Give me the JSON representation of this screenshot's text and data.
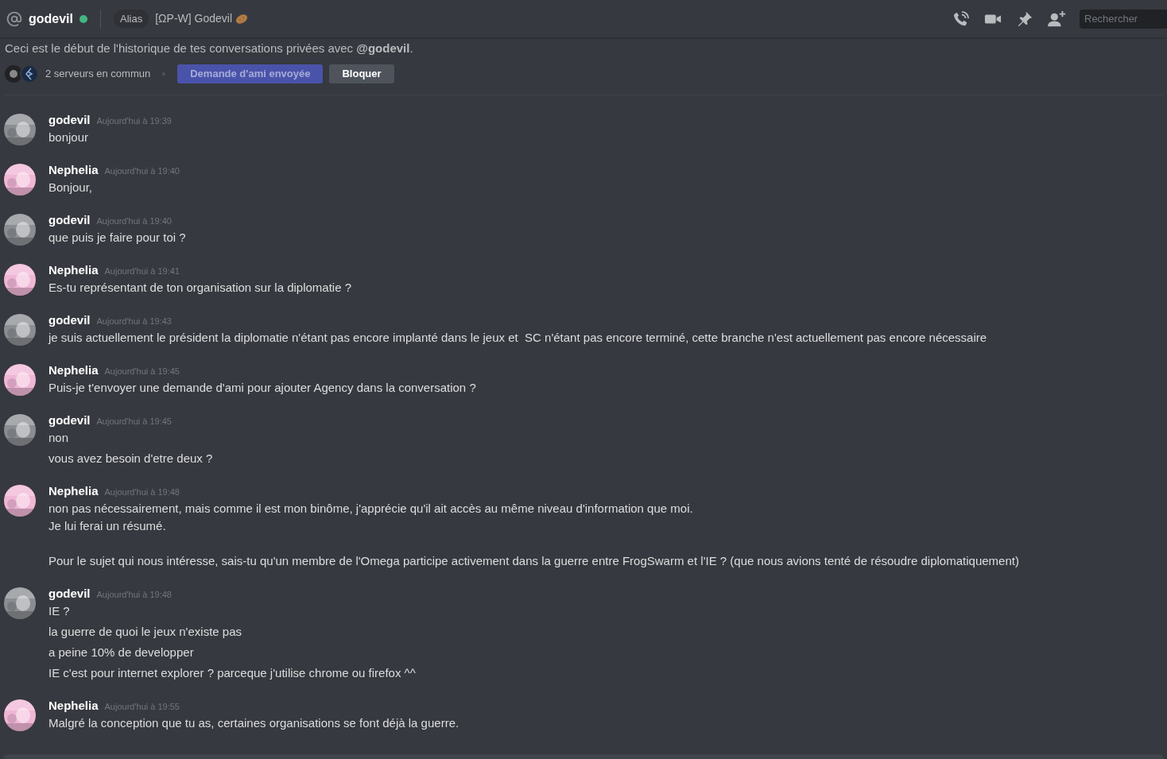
{
  "header": {
    "title": "godevil",
    "online": true,
    "alias_badge": "Alias",
    "alias": "[ΩP-W] Godevil",
    "search": {
      "placeholder": "Rechercher"
    }
  },
  "intro": {
    "text": "Ceci est le début de l'historique de tes conversations privées avec **@godevil**.",
    "mutual_servers": "2 serveurs en commun",
    "friend_button": {
      "label": "Demande d'ami envoyée",
      "disabled": true
    },
    "block_button": {
      "label": "Bloquer",
      "disabled": false
    }
  },
  "messages": [
    {
      "author": "godevil",
      "time": "Aujourd'hui à 19:39",
      "color": "#8a8d92",
      "blocks": [
        [
          "bonjour"
        ]
      ]
    },
    {
      "author": "Nephelia",
      "time": "Aujourd'hui à 19:40",
      "color": "#f0b6d6",
      "blocks": [
        [
          "Bonjour,"
        ]
      ]
    },
    {
      "author": "godevil",
      "time": "Aujourd'hui à 19:40",
      "color": "#8a8d92",
      "blocks": [
        [
          "que puis je faire pour toi ?"
        ]
      ]
    },
    {
      "author": "Nephelia",
      "time": "Aujourd'hui à 19:41",
      "color": "#f0b6d6",
      "blocks": [
        [
          "Es-tu représentant de ton organisation sur la diplomatie ?"
        ]
      ]
    },
    {
      "author": "godevil",
      "time": "Aujourd'hui à 19:43",
      "color": "#8a8d92",
      "blocks": [
        [
          "je suis actuellement le président la diplomatie n'étant pas encore implanté dans le jeux et  SC n'étant pas encore terminé, cette branche n'est actuellement pas encore nécessaire"
        ]
      ]
    },
    {
      "author": "Nephelia",
      "time": "Aujourd'hui à 19:45",
      "color": "#f0b6d6",
      "blocks": [
        [
          "Puis-je t'envoyer une demande d'ami pour ajouter Agency dans la conversation ?"
        ]
      ]
    },
    {
      "author": "godevil",
      "time": "Aujourd'hui à 19:45",
      "color": "#8a8d92",
      "blocks": [
        [
          "non"
        ],
        [
          "vous avez besoin d'etre deux ?"
        ]
      ]
    },
    {
      "author": "Nephelia",
      "time": "Aujourd'hui à 19:48",
      "color": "#f0b6d6",
      "kind": "paragraphs",
      "blocks": [
        [
          "non pas nécessairement, mais comme il est mon binôme, j'apprécie qu'il ait accès au même niveau d'information que moi.",
          "Je lui ferai un résumé."
        ],
        [
          "Pour le sujet qui nous intéresse, sais-tu qu'un membre de l'Omega participe activement dans la guerre entre FrogSwarm et l'IE ? (que nous avions tenté de résoudre diplomatiquement)"
        ]
      ]
    },
    {
      "author": "godevil",
      "time": "Aujourd'hui à 19:48",
      "color": "#8a8d92",
      "blocks": [
        [
          "IE ?"
        ],
        [
          "la guerre de quoi le jeux n'existe pas"
        ],
        [
          "a peine 10% de developper"
        ],
        [
          "IE c'est pour internet explorer ? parceque j'utilise chrome ou firefox ^^"
        ]
      ]
    },
    {
      "author": "Nephelia",
      "time": "Aujourd'hui à 19:55",
      "color": "#f0b6d6",
      "blocks": [
        [
          "Malgré la conception que tu as, certaines organisations se font déjà la guerre."
        ]
      ]
    }
  ]
}
